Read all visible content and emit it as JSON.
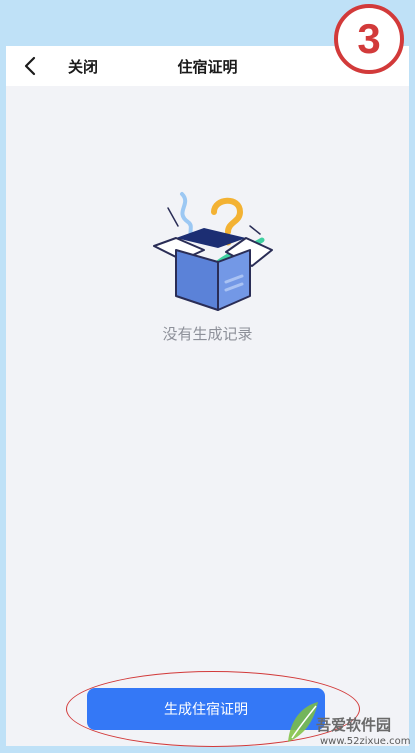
{
  "header": {
    "close_label": "关闭",
    "title": "住宿证明"
  },
  "empty_state": {
    "text": "没有生成记录"
  },
  "primary_action": {
    "label": "生成住宿证明"
  },
  "annotation": {
    "step_number": "3"
  },
  "watermark": {
    "name": "吾爱软件园",
    "url": "www.52zixue.com"
  },
  "colors": {
    "accent": "#3478f6",
    "annotation_red": "#d23a3a",
    "page_bg": "#f2f3f7",
    "outer_bg": "#bfe1f7"
  }
}
